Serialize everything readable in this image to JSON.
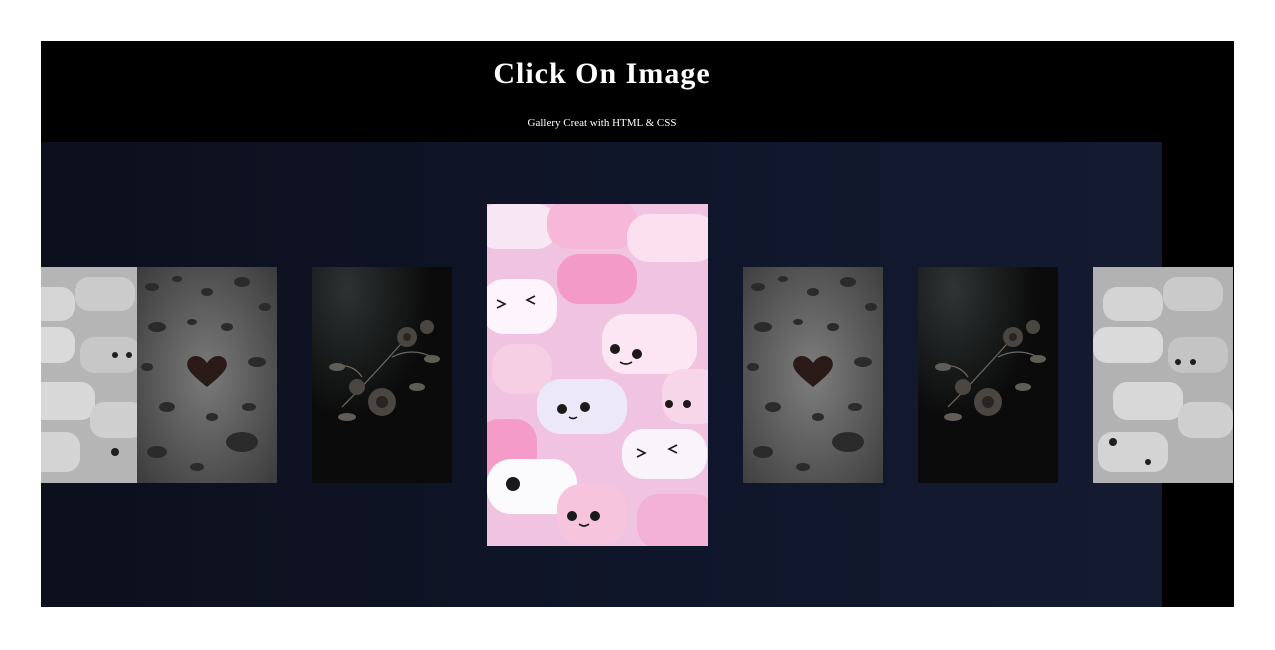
{
  "header": {
    "title": "Click On Image",
    "subtitle": "Gallery Creat with HTML & CSS"
  },
  "gallery": {
    "images": [
      {
        "subject": "marshmallows",
        "state": "dimmed"
      },
      {
        "subject": "water-drops-heart",
        "state": "dimmed"
      },
      {
        "subject": "dark-flowers",
        "state": "dimmed"
      },
      {
        "subject": "marshmallows",
        "state": "featured"
      },
      {
        "subject": "water-drops-heart",
        "state": "dimmed"
      },
      {
        "subject": "dark-flowers",
        "state": "dimmed"
      },
      {
        "subject": "marshmallows",
        "state": "dimmed"
      }
    ]
  },
  "colors": {
    "background": "#000000",
    "stage": "#10162a",
    "accent_pink": "#f3a6cc"
  }
}
